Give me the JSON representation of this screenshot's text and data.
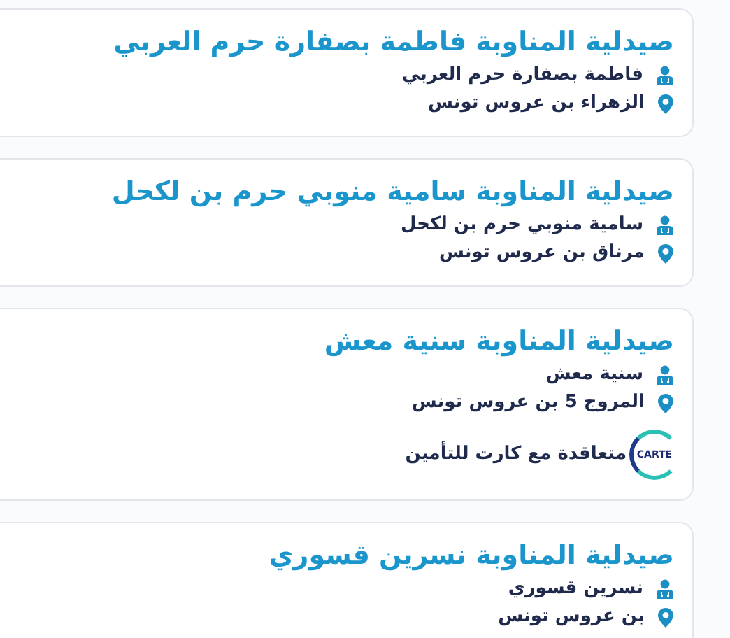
{
  "pharmacies": [
    {
      "title": "صيدلية المناوبة فاطمة بصفارة حرم العربي",
      "owner": "فاطمة بصفارة حرم العربي",
      "address": "الزهراء بن عروس تونس"
    },
    {
      "title": "صيدلية المناوبة سامية منوبي حرم بن لكحل",
      "owner": "سامية منوبي حرم بن لكحل",
      "address": "مرناق بن عروس تونس"
    },
    {
      "title": "صيدلية المناوبة سنية معش",
      "owner": "سنية معش",
      "address": "المروج 5 بن عروس تونس",
      "insurance": {
        "logo_text": "CARTE",
        "label": "متعاقدة مع كارت للتأمين"
      }
    },
    {
      "title": "صيدلية المناوبة نسرين قسوري",
      "owner": "نسرين قسوري",
      "address": "بن عروس تونس"
    }
  ]
}
